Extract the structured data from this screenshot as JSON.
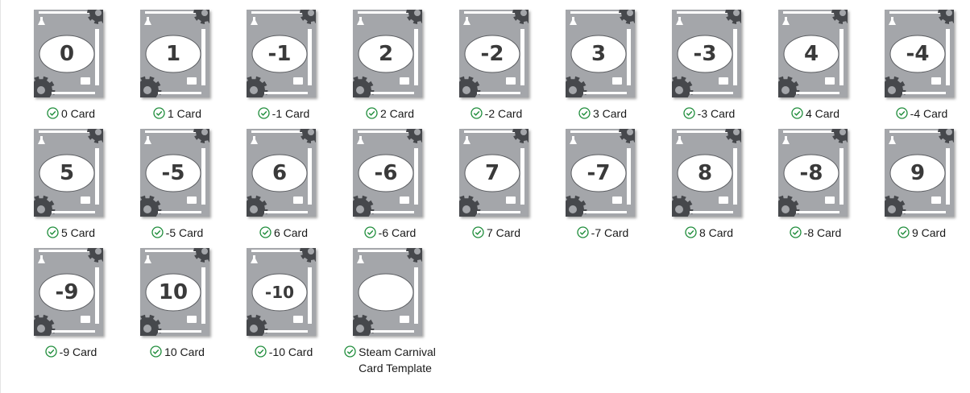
{
  "colors": {
    "card_bg": "#a4a6aa",
    "dark_gear": "#46484c",
    "oval": "#ffffff",
    "sync_check": "#1e8c3a"
  },
  "files": [
    {
      "name": "0 Card",
      "numeral": "0",
      "status": "synced"
    },
    {
      "name": "1 Card",
      "numeral": "1",
      "status": "synced"
    },
    {
      "name": "-1 Card",
      "numeral": "-1",
      "status": "synced"
    },
    {
      "name": "2 Card",
      "numeral": "2",
      "status": "synced"
    },
    {
      "name": "-2 Card",
      "numeral": "-2",
      "status": "synced"
    },
    {
      "name": "3 Card",
      "numeral": "3",
      "status": "synced"
    },
    {
      "name": "-3 Card",
      "numeral": "-3",
      "status": "synced"
    },
    {
      "name": "4 Card",
      "numeral": "4",
      "status": "synced"
    },
    {
      "name": "-4 Card",
      "numeral": "-4",
      "status": "synced"
    },
    {
      "name": "5 Card",
      "numeral": "5",
      "status": "synced"
    },
    {
      "name": "-5 Card",
      "numeral": "-5",
      "status": "synced"
    },
    {
      "name": "6 Card",
      "numeral": "6",
      "status": "synced"
    },
    {
      "name": "-6 Card",
      "numeral": "-6",
      "status": "synced"
    },
    {
      "name": "7 Card",
      "numeral": "7",
      "status": "synced"
    },
    {
      "name": "-7 Card",
      "numeral": "-7",
      "status": "synced"
    },
    {
      "name": "8 Card",
      "numeral": "8",
      "status": "synced"
    },
    {
      "name": "-8 Card",
      "numeral": "-8",
      "status": "synced"
    },
    {
      "name": "9 Card",
      "numeral": "9",
      "status": "synced"
    },
    {
      "name": "-9 Card",
      "numeral": "-9",
      "status": "synced"
    },
    {
      "name": "10 Card",
      "numeral": "10",
      "status": "synced"
    },
    {
      "name": "-10 Card",
      "numeral": "-10",
      "status": "synced"
    },
    {
      "name": "Steam Carnival\nCard Template",
      "numeral": "",
      "status": "synced"
    }
  ]
}
